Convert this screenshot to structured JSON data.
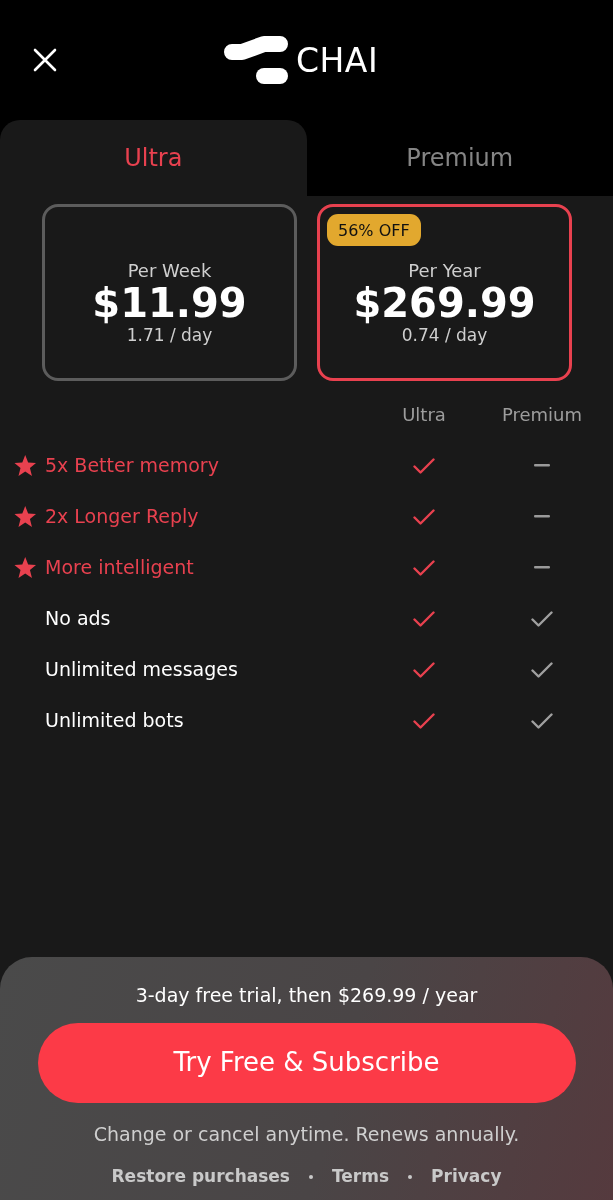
{
  "header": {
    "brand": "CHAI"
  },
  "tabs": [
    {
      "label": "Ultra",
      "selected": true
    },
    {
      "label": "Premium",
      "selected": false
    }
  ],
  "plans": [
    {
      "period": "Per Week",
      "price": "$11.99",
      "per_day": "1.71 / day",
      "selected": false
    },
    {
      "badge": "56% OFF",
      "period": "Per Year",
      "price": "$269.99",
      "per_day": "0.74 / day",
      "selected": true
    }
  ],
  "comparison": {
    "columns": [
      "Ultra",
      "Premium"
    ],
    "rows": [
      {
        "label": "5x Better memory",
        "highlighted": true,
        "included": [
          true,
          false
        ]
      },
      {
        "label": "2x Longer Reply",
        "highlighted": true,
        "included": [
          true,
          false
        ]
      },
      {
        "label": "More intelligent",
        "highlighted": true,
        "included": [
          true,
          false
        ]
      },
      {
        "label": "No ads",
        "highlighted": false,
        "included": [
          true,
          true
        ]
      },
      {
        "label": "Unlimited messages",
        "highlighted": false,
        "included": [
          true,
          true
        ]
      },
      {
        "label": "Unlimited bots",
        "highlighted": false,
        "included": [
          true,
          true
        ]
      }
    ]
  },
  "footer": {
    "trial_text": "3-day free trial, then $269.99 / year",
    "cta": "Try Free & Subscribe",
    "note": "Change or cancel anytime. Renews annually.",
    "links": [
      "Restore purchases",
      "Terms",
      "Privacy"
    ]
  }
}
